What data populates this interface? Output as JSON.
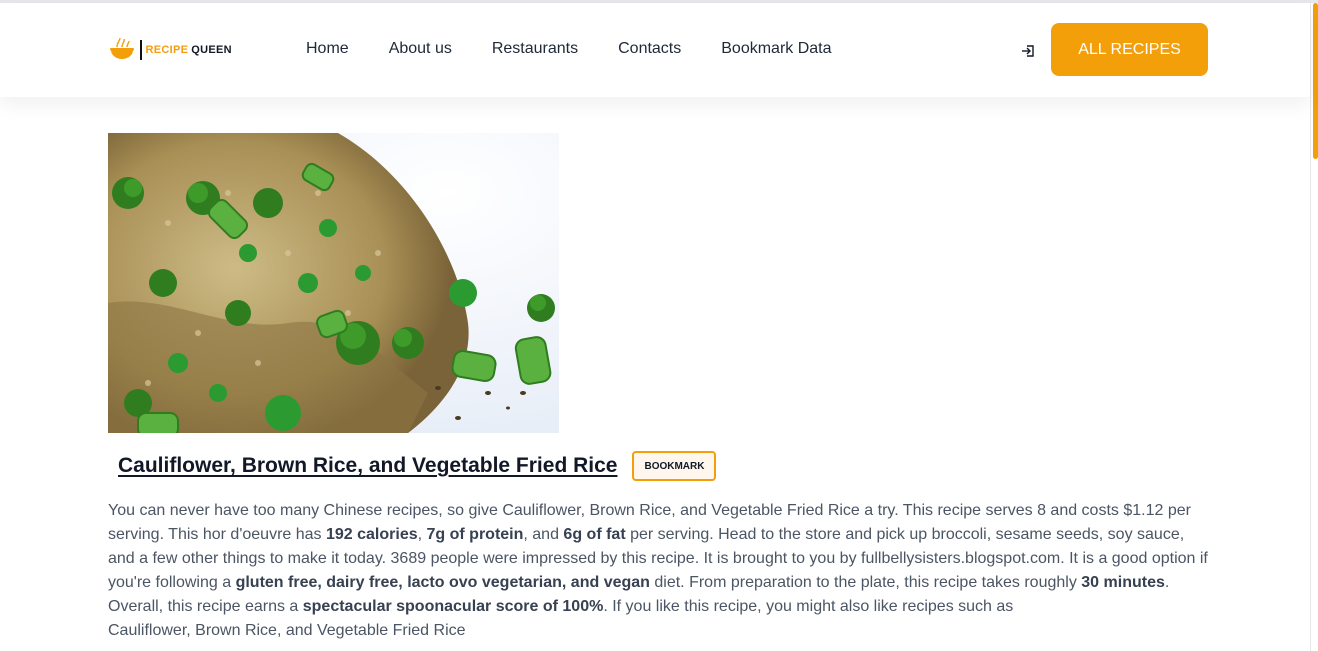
{
  "header": {
    "logo": {
      "accent": "RECIPE",
      "main": "QUEEN"
    },
    "nav": [
      "Home",
      "About us",
      "Restaurants",
      "Contacts",
      "Bookmark Data"
    ],
    "login_icon": "login-icon",
    "cta_label": "ALL RECIPES"
  },
  "recipe": {
    "image": "fried-rice-photo",
    "title": "Cauliflower, Brown Rice, and Vegetable Fried Rice",
    "bookmark_label": "BOOKMARK",
    "summary": {
      "t1": "You can never have too many Chinese recipes, so give Cauliflower, Brown Rice, and Vegetable Fried Rice a try. This recipe serves 8 and costs $1.12 per serving. This hor d'oeuvre has ",
      "b1": "192 calories",
      "t2": ", ",
      "b2": "7g of protein",
      "t3": ", and ",
      "b3": "6g of fat",
      "t4": " per serving. Head to the store and pick up broccoli, sesame seeds, soy sauce, and a few other things to make it today. 3689 people were impressed by this recipe. It is brought to you by fullbellysisters.blogspot.com. It is a good option if you're following a ",
      "b4": "gluten free, dairy free, lacto ovo vegetarian, and vegan",
      "t5": " diet. From preparation to the plate, this recipe takes roughly ",
      "b5": "30 minutes",
      "t6": ". Overall, this recipe earns a ",
      "b6": "spectacular spoonacular score of 100%",
      "t7": ". If you like this recipe, you might also like recipes such as",
      "link": "Cauliflower, Brown Rice, and Vegetable Fried Rice"
    }
  },
  "colors": {
    "accent": "#f29f0a",
    "text": "#4b5563",
    "heading": "#111827"
  }
}
